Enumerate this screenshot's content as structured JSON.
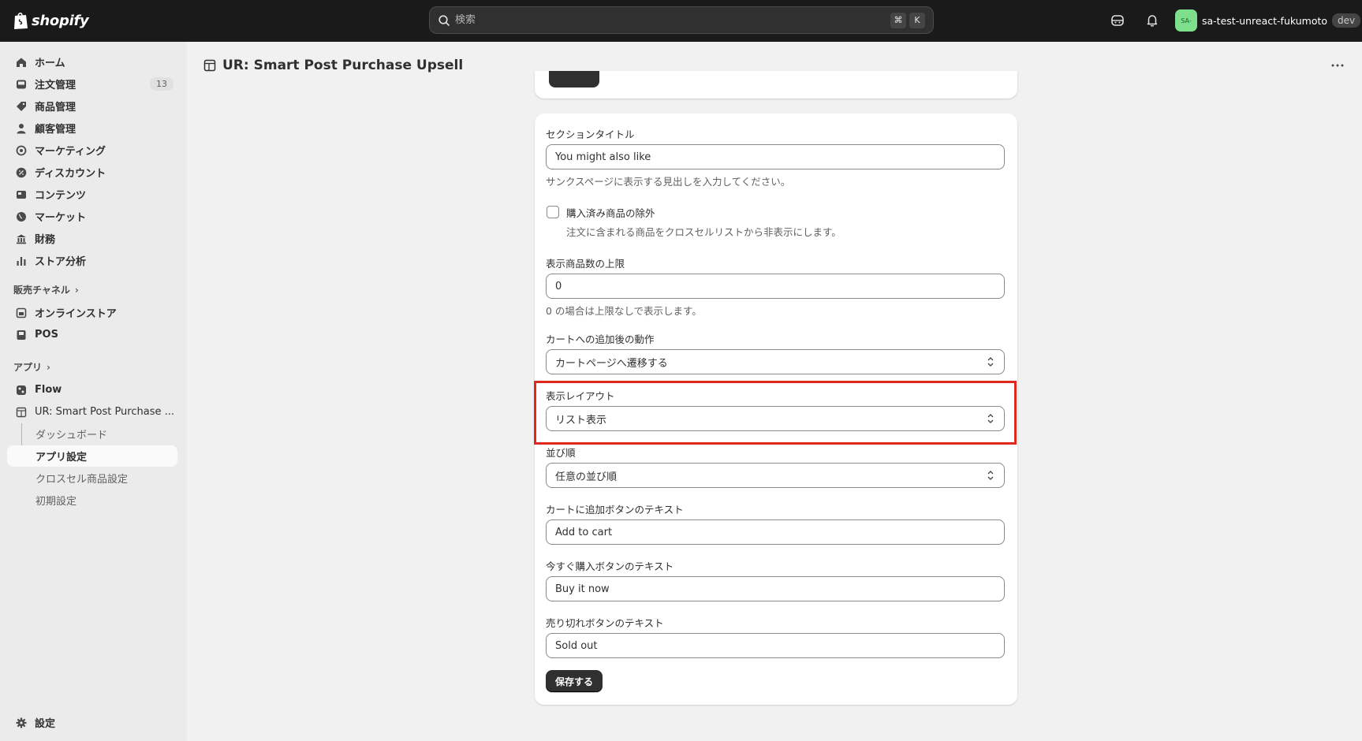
{
  "topbar": {
    "brand": "shopify",
    "search_placeholder": "検索",
    "shortcut_keys": [
      "⌘",
      "K"
    ],
    "store_avatar": "SA-",
    "store_name": "sa-test-unreact-fukumoto",
    "store_badge": "dev"
  },
  "sidebar": {
    "items": [
      {
        "label": "ホーム",
        "icon": "home-icon"
      },
      {
        "label": "注文管理",
        "icon": "inbox-icon",
        "badge": "13"
      },
      {
        "label": "商品管理",
        "icon": "tag-icon"
      },
      {
        "label": "顧客管理",
        "icon": "person-icon"
      },
      {
        "label": "マーケティング",
        "icon": "target-icon"
      },
      {
        "label": "ディスカウント",
        "icon": "discount-icon"
      },
      {
        "label": "コンテンツ",
        "icon": "content-icon"
      },
      {
        "label": "マーケット",
        "icon": "globe-icon"
      },
      {
        "label": "財務",
        "icon": "bank-icon"
      },
      {
        "label": "ストア分析",
        "icon": "chart-icon"
      }
    ],
    "sales_channels_heading": "販売チャネル",
    "sales_channels": [
      {
        "label": "オンラインストア",
        "icon": "store-icon"
      },
      {
        "label": "POS",
        "icon": "pos-icon"
      }
    ],
    "apps_heading": "アプリ",
    "apps": [
      {
        "label": "Flow",
        "icon": "flow-icon"
      },
      {
        "label": "UR: Smart Post Purchase ...",
        "icon": "app-icon"
      }
    ],
    "app_subitems": [
      "ダッシュボード",
      "アプリ設定",
      "クロスセル商品設定",
      "初期設定"
    ],
    "settings_label": "設定"
  },
  "page": {
    "title": "UR: Smart Post Purchase Upsell"
  },
  "form": {
    "section_title": {
      "label": "セクションタイトル",
      "value": "You might also like",
      "help": "サンクスページに表示する見出しを入力してください。"
    },
    "exclude_purchased": {
      "label": "購入済み商品の除外",
      "help": "注文に含まれる商品をクロスセルリストから非表示にします。",
      "checked": false
    },
    "max_products": {
      "label": "表示商品数の上限",
      "value": "0",
      "help": "0 の場合は上限なしで表示します。"
    },
    "after_add_action": {
      "label": "カートへの追加後の動作",
      "value": "カートページへ遷移する"
    },
    "display_layout": {
      "label": "表示レイアウト",
      "value": "リスト表示"
    },
    "sort_order": {
      "label": "並び順",
      "value": "任意の並び順"
    },
    "add_to_cart_text": {
      "label": "カートに追加ボタンのテキスト",
      "value": "Add to cart"
    },
    "buy_now_text": {
      "label": "今すぐ購入ボタンのテキスト",
      "value": "Buy it now"
    },
    "sold_out_text": {
      "label": "売り切れボタンのテキスト",
      "value": "Sold out"
    },
    "save_label": "保存する"
  },
  "colors": {
    "topbar": "#1a1a1a",
    "highlight": "#e0291e",
    "primary_button": "#303030"
  }
}
